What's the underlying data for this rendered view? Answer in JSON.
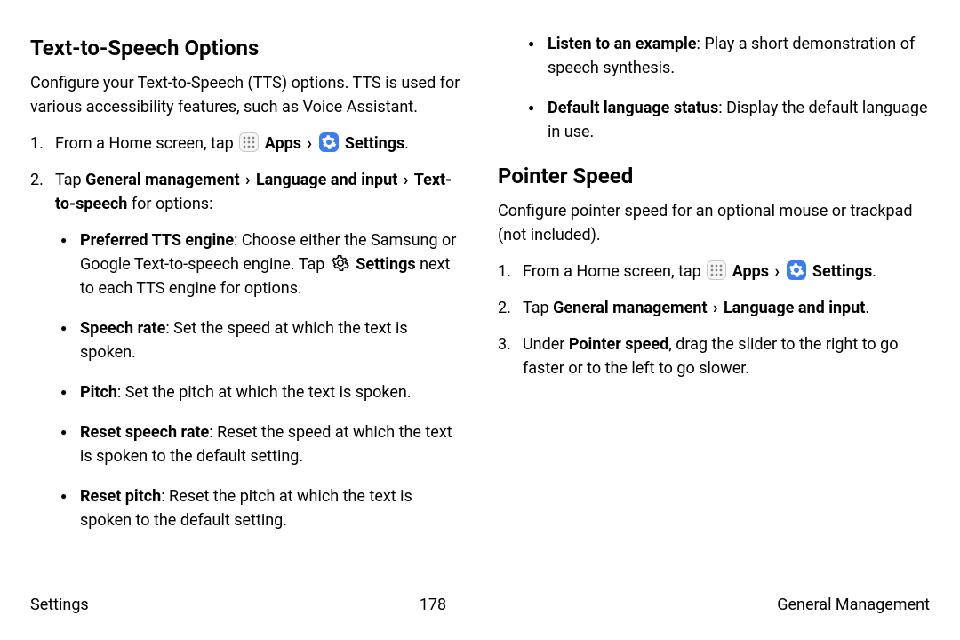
{
  "left": {
    "heading": "Text-to-Speech Options",
    "intro": "Configure your Text-to-Speech (TTS) options. TTS is used for various accessibility features, such as Voice Assistant.",
    "step1_a": "From a Home screen, tap ",
    "apps": "Apps",
    "settings": "Settings",
    "step2_a": "Tap ",
    "step2_b": "General management",
    "step2_c": "Language and input",
    "step2_d": "Text-to-speech",
    "step2_e": " for options:",
    "bullets": {
      "b1_t": "Preferred TTS engine",
      "b1_a": ": Choose either the Samsung or Google Text-to-speech engine. Tap ",
      "b1_b": "Settings",
      "b1_c": " next to each TTS engine for options.",
      "b2_t": "Speech rate",
      "b2_a": ": Set the speed at which the text is spoken.",
      "b3_t": "Pitch",
      "b3_a": ": Set the pitch at which the text is spoken.",
      "b4_t": "Reset speech rate",
      "b4_a": ": Reset the speed at which the text is spoken to the default setting.",
      "b5_t": "Reset pitch",
      "b5_a": ": Reset the pitch at which the text is spoken to the default setting."
    }
  },
  "right": {
    "bullets_cont": {
      "b6_t": "Listen to an example",
      "b6_a": ": Play a short demonstration of speech synthesis.",
      "b7_t": "Default language status",
      "b7_a": ": Display the default language in use."
    },
    "heading": "Pointer Speed",
    "intro": "Configure pointer speed for an optional mouse or trackpad (not included).",
    "step1_a": "From a Home screen, tap ",
    "apps": "Apps",
    "settings": "Settings",
    "step2_a": "Tap ",
    "step2_b": "General management",
    "step2_c": "Language and input",
    "step3_a": "Under ",
    "step3_b": "Pointer speed",
    "step3_c": ", drag the slider to the right to go faster or to the left to go slower."
  },
  "footer": {
    "left": "Settings",
    "center": "178",
    "right": "General Management"
  }
}
